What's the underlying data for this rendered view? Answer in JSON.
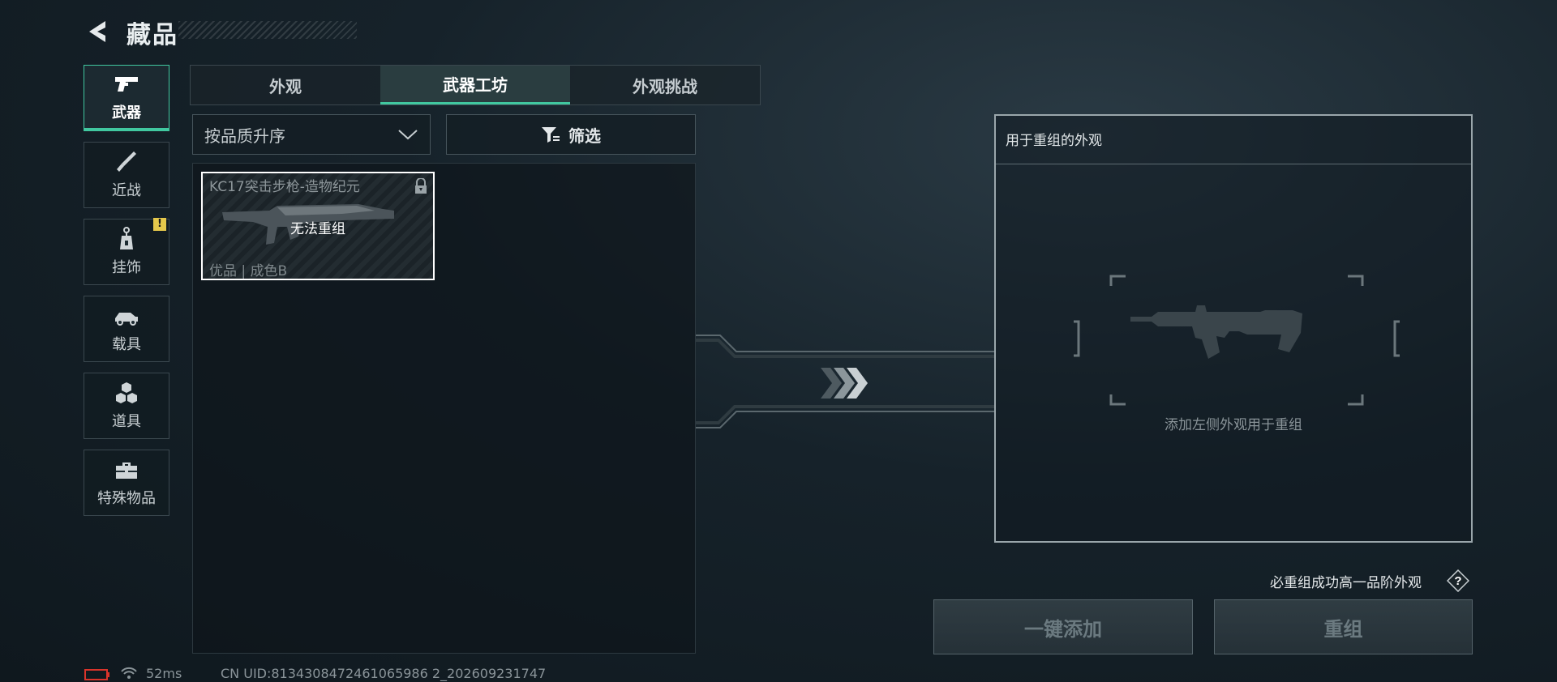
{
  "header": {
    "title": "藏品"
  },
  "sidebar": {
    "items": [
      {
        "label": "武器",
        "icon": "pistol-icon",
        "active": true
      },
      {
        "label": "近战",
        "icon": "knife-icon"
      },
      {
        "label": "挂饰",
        "icon": "charm-icon",
        "badge": "!"
      },
      {
        "label": "载具",
        "icon": "vehicle-icon"
      },
      {
        "label": "道具",
        "icon": "cubes-icon"
      },
      {
        "label": "特殊物品",
        "icon": "toolbox-icon"
      }
    ]
  },
  "tabs": [
    {
      "label": "外观"
    },
    {
      "label": "武器工坊",
      "active": true
    },
    {
      "label": "外观挑战"
    }
  ],
  "sort": {
    "label": "按品质升序"
  },
  "filter": {
    "label": "筛选"
  },
  "items": [
    {
      "name": "KC17突击步枪-造物纪元",
      "status": "无法重组",
      "quality": "优品 | 成色B",
      "locked": true
    }
  ],
  "recombine_panel": {
    "title": "用于重组的外观",
    "hint": "添加左侧外观用于重组"
  },
  "bottom": {
    "guarantee_text": "必重组成功高一品阶外观",
    "help": "?",
    "add_all_label": "一键添加",
    "recombine_label": "重组"
  },
  "status_bar": {
    "ping": "52ms",
    "uid": "CN UID:8134308472461065986 2_202609231747"
  },
  "colors": {
    "accent": "#41c8a0",
    "warning": "#e5c84b"
  }
}
